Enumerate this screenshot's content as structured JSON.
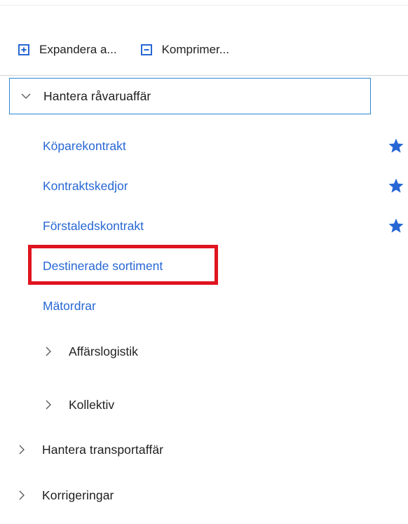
{
  "toolbar": {
    "expand_all_label": "Expandera a...",
    "expand_all_icon": "plus-box-icon",
    "collapse_all_label": "Komprimer...",
    "collapse_all_icon": "minus-box-icon"
  },
  "tree": {
    "expanded_group": {
      "label": "Hantera råvaruaffär",
      "icon": "chevron-down-icon",
      "links": [
        {
          "label": "Köparekontrakt",
          "favorite": true
        },
        {
          "label": "Kontraktskedjor",
          "favorite": true
        },
        {
          "label": "Förstaledskontrakt",
          "favorite": true
        },
        {
          "label": "Destinerade sortiment",
          "favorite": false,
          "highlighted": true
        },
        {
          "label": "Mätordrar",
          "favorite": false
        }
      ],
      "sub_groups": [
        {
          "label": "Affärslogistik",
          "icon": "chevron-right-icon"
        },
        {
          "label": "Kollektiv",
          "icon": "chevron-right-icon"
        }
      ]
    },
    "collapsed_groups": [
      {
        "label": "Hantera transportaffär",
        "icon": "chevron-right-icon"
      },
      {
        "label": "Korrigeringar",
        "icon": "chevron-right-icon"
      }
    ]
  },
  "colors": {
    "link": "#2767d4",
    "star": "#2767d4",
    "highlight": "#e0141f",
    "focus_border": "#2b88d8"
  }
}
